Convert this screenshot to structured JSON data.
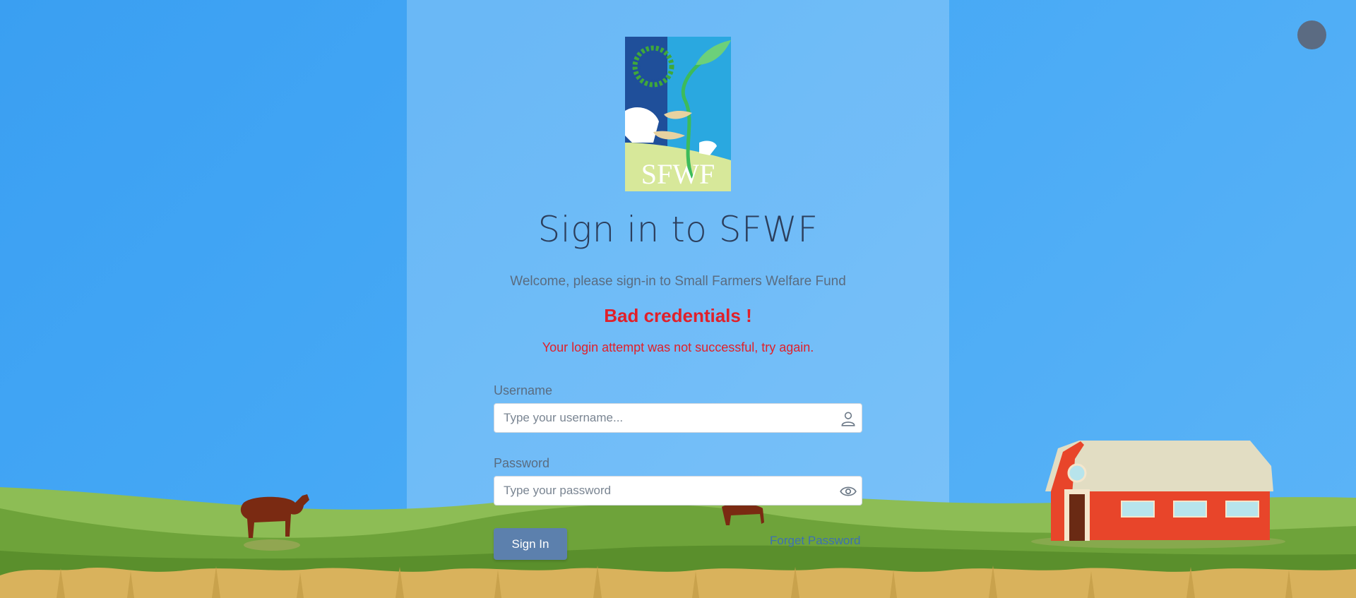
{
  "brand": {
    "logo_text": "SFWF"
  },
  "heading": "Sign in to SFWF",
  "welcome_text": "Welcome, please sign-in to Small Farmers Welfare Fund",
  "error": {
    "title": "Bad credentials !",
    "message": "Your login attempt was not successful, try again."
  },
  "form": {
    "username_label": "Username",
    "username_placeholder": "Type your username...",
    "username_value": "",
    "password_label": "Password",
    "password_placeholder": "Type your password",
    "password_value": "",
    "submit_label": "Sign In",
    "forgot_label": "Forget Password"
  },
  "icons": {
    "username_icon": "user-icon",
    "password_icon": "eye-icon",
    "avatar": "avatar-circle"
  },
  "colors": {
    "background": "#3a9ff2",
    "error": "#e0202a",
    "button": "#5c80ad",
    "link": "#3d6fb3",
    "avatar": "#5b6b82"
  }
}
